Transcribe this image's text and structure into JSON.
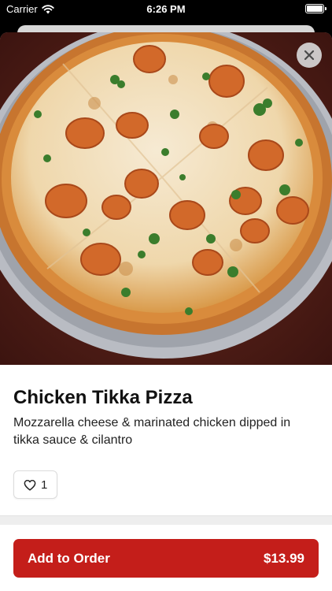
{
  "status_bar": {
    "carrier": "Carrier",
    "time": "6:26 PM"
  },
  "item": {
    "image": "chicken-tikka-pizza-photo",
    "title": "Chicken Tikka Pizza",
    "description": "Mozzarella cheese & marinated chicken dipped in tikka sauce & cilantro",
    "likes": "1"
  },
  "actions": {
    "add_label": "Add to Order",
    "price": "$13.99"
  },
  "colors": {
    "accent": "#c41e1a",
    "background": "#ffffff"
  },
  "icons": {
    "close": "close-icon",
    "like": "heart-icon",
    "wifi": "wifi-icon",
    "battery": "battery-icon"
  }
}
